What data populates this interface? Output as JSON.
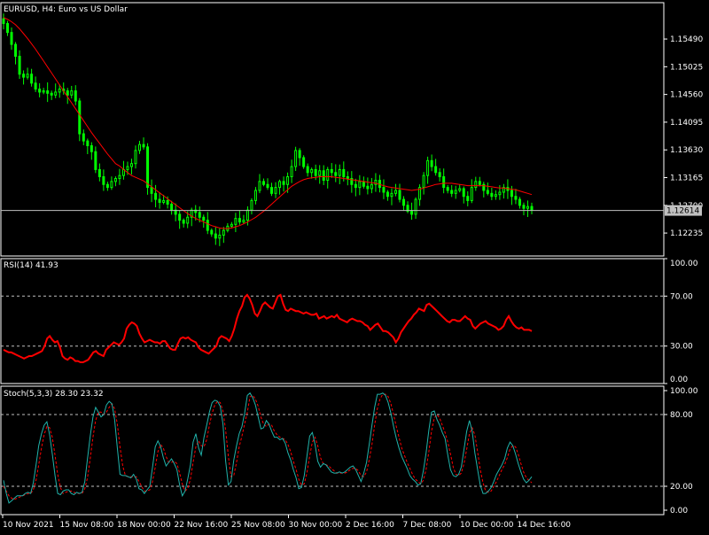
{
  "main": {
    "title": "EURUSD, H4:  Euro vs US Dollar",
    "ylim": [
      1.1185,
      1.161
    ],
    "ticks": [
      {
        "label": "1.15490",
        "value": 1.1549
      },
      {
        "label": "1.15025",
        "value": 1.15025
      },
      {
        "label": "1.14560",
        "value": 1.1456
      },
      {
        "label": "1.14095",
        "value": 1.14095
      },
      {
        "label": "1.13630",
        "value": 1.1363
      },
      {
        "label": "1.13165",
        "value": 1.13165
      },
      {
        "label": "1.12700",
        "value": 1.127
      },
      {
        "label": "1.12235",
        "value": 1.12235
      }
    ],
    "current_price": "1.12614",
    "current_value": 1.12614,
    "colors": {
      "candle": "#00ff00",
      "ma": "#ff0000",
      "price_line": "#c0c0c0",
      "price_box": "#c0c0c0"
    }
  },
  "rsi": {
    "label": "RSI(14) 41.93",
    "ylim": [
      0,
      100
    ],
    "ticks": [
      {
        "label": "100.00",
        "value": 100
      },
      {
        "label": "70.00",
        "value": 70
      },
      {
        "label": "30.00",
        "value": 30
      },
      {
        "label": "0.00",
        "value": 0
      }
    ],
    "levels": [
      70,
      30
    ],
    "color": "#ff0000"
  },
  "stoch": {
    "label": "Stoch(5,3,3) 28.30 23.32",
    "ylim": [
      0,
      100
    ],
    "ticks": [
      {
        "label": "100.00",
        "value": 100
      },
      {
        "label": "80.00",
        "value": 80
      },
      {
        "label": "20.00",
        "value": 20
      },
      {
        "label": "0.00",
        "value": 0
      }
    ],
    "levels": [
      80,
      20
    ],
    "main_color": "#20b2aa",
    "signal_color": "#ff0000"
  },
  "time_axis": [
    "10 Nov 2021",
    "15 Nov 08:00",
    "18 Nov 00:00",
    "22 Nov 16:00",
    "25 Nov 08:00",
    "30 Nov 00:00",
    "2 Dec 16:00",
    "7 Dec 08:00",
    "10 Dec 00:00",
    "14 Dec 16:00"
  ],
  "chart_data": [
    {
      "type": "candlestick",
      "title": "EURUSD, H4:  Euro vs US Dollar",
      "x_labels": [
        "10 Nov 2021",
        "15 Nov 08:00",
        "18 Nov 00:00",
        "22 Nov 16:00",
        "25 Nov 08:00",
        "30 Nov 00:00",
        "2 Dec 16:00",
        "7 Dec 08:00",
        "10 Dec 00:00",
        "14 Dec 16:00"
      ],
      "close": [
        1.1575,
        1.156,
        1.154,
        1.152,
        1.149,
        1.1485,
        1.149,
        1.1475,
        1.1465,
        1.146,
        1.1462,
        1.1458,
        1.1455,
        1.146,
        1.1465,
        1.1462,
        1.1455,
        1.1462,
        1.1445,
        1.139,
        1.1378,
        1.137,
        1.136,
        1.133,
        1.1318,
        1.1305,
        1.13,
        1.131,
        1.1315,
        1.132,
        1.133,
        1.1335,
        1.134,
        1.1362,
        1.1372,
        1.1368,
        1.13,
        1.129,
        1.128,
        1.1275,
        1.1278,
        1.1272,
        1.1262,
        1.1255,
        1.1245,
        1.124,
        1.125,
        1.1262,
        1.1258,
        1.125,
        1.1245,
        1.1228,
        1.1222,
        1.1215,
        1.122,
        1.1228,
        1.1235,
        1.1238,
        1.1248,
        1.1242,
        1.1245,
        1.1262,
        1.1278,
        1.1295,
        1.131,
        1.1305,
        1.13,
        1.129,
        1.13,
        1.131,
        1.1305,
        1.1318,
        1.1335,
        1.1362,
        1.135,
        1.1335,
        1.1325,
        1.133,
        1.132,
        1.1328,
        1.1312,
        1.133,
        1.1325,
        1.132,
        1.133,
        1.1318,
        1.1315,
        1.1305,
        1.13,
        1.131,
        1.1302,
        1.1298,
        1.1305,
        1.1312,
        1.13,
        1.1292,
        1.1285,
        1.129,
        1.1295,
        1.128,
        1.127,
        1.126,
        1.1255,
        1.128,
        1.13,
        1.132,
        1.1345,
        1.1335,
        1.1325,
        1.1318,
        1.13,
        1.1295,
        1.129,
        1.1295,
        1.1298,
        1.1285,
        1.1278,
        1.13,
        1.131,
        1.1305,
        1.1295,
        1.129,
        1.1285,
        1.1288,
        1.1292,
        1.13,
        1.1295,
        1.1285,
        1.128,
        1.127,
        1.1265,
        1.1268,
        1.1262
      ],
      "ma": [
        1.1585,
        1.1582,
        1.1578,
        1.1573,
        1.1566,
        1.1558,
        1.155,
        1.1541,
        1.1532,
        1.1522,
        1.1512,
        1.1502,
        1.1492,
        1.1482,
        1.1472,
        1.1462,
        1.1452,
        1.1442,
        1.1432,
        1.1422,
        1.1412,
        1.1402,
        1.1392,
        1.1383,
        1.1374,
        1.1365,
        1.1356,
        1.1348,
        1.134,
        1.1336,
        1.133,
        1.1325,
        1.132,
        1.1317,
        1.1314,
        1.1311,
        1.1306,
        1.1301,
        1.1296,
        1.1291,
        1.1286,
        1.1281,
        1.1276,
        1.1271,
        1.1266,
        1.1261,
        1.1256,
        1.1252,
        1.1248,
        1.1245,
        1.1242,
        1.1239,
        1.1236,
        1.1234,
        1.1232,
        1.1231,
        1.1231,
        1.1232,
        1.1234,
        1.1236,
        1.1239,
        1.1242,
        1.1246,
        1.125,
        1.1255,
        1.126,
        1.1266,
        1.1272,
        1.1278,
        1.1284,
        1.129,
        1.1296,
        1.1302,
        1.1306,
        1.131,
        1.1313,
        1.1315,
        1.1316,
        1.1317,
        1.1318,
        1.1318,
        1.1318,
        1.1318,
        1.1317,
        1.1316,
        1.1315,
        1.1314,
        1.1313,
        1.1312,
        1.1311,
        1.131,
        1.1309,
        1.1308,
        1.1307,
        1.1305,
        1.1303,
        1.1301,
        1.13,
        1.1299,
        1.1298,
        1.1297,
        1.1296,
        1.1295,
        1.1296,
        1.1297,
        1.1299,
        1.1301,
        1.1303,
        1.1305,
        1.1306,
        1.1307,
        1.1307,
        1.1307,
        1.1306,
        1.1305,
        1.1304,
        1.1303,
        1.1303,
        1.1303,
        1.1303,
        1.1303,
        1.1302,
        1.1301,
        1.13,
        1.1299,
        1.1299,
        1.1298,
        1.1297,
        1.1296,
        1.1294,
        1.1292,
        1.129,
        1.1288
      ]
    },
    {
      "type": "line",
      "title": "RSI(14) 41.93",
      "ylim": [
        0,
        100
      ],
      "values": [
        27,
        26,
        25,
        25,
        24,
        23,
        22,
        21,
        20,
        21,
        22,
        22,
        23,
        24,
        25,
        26,
        30,
        36,
        38,
        35,
        33,
        34,
        29,
        22,
        20,
        19,
        21,
        20,
        18,
        18,
        17,
        17,
        18,
        19,
        22,
        25,
        26,
        24,
        23,
        22,
        27,
        29,
        31,
        33,
        32,
        31,
        33,
        36,
        44,
        47,
        49,
        48,
        46,
        40,
        36,
        33,
        34,
        35,
        34,
        33,
        33,
        32,
        34,
        34,
        31,
        28,
        27,
        27,
        32,
        36,
        37,
        36,
        37,
        35,
        34,
        33,
        29,
        27,
        26,
        25,
        24,
        26,
        28,
        30,
        36,
        38,
        37,
        36,
        34,
        38,
        44,
        52,
        58,
        62,
        69,
        71,
        68,
        63,
        56,
        54,
        58,
        63,
        65,
        63,
        61,
        60,
        65,
        70,
        71,
        64,
        59,
        58,
        60,
        59,
        58,
        58,
        57,
        56,
        57,
        56,
        55,
        55,
        56,
        52,
        53,
        54,
        52,
        53,
        54,
        53,
        55,
        52,
        51,
        50,
        49,
        51,
        52,
        51,
        50,
        50,
        49,
        47,
        46,
        43,
        45,
        47,
        48,
        45,
        42,
        42,
        41,
        39,
        37,
        33,
        36,
        41,
        44,
        47,
        50,
        52,
        55,
        57,
        60,
        59,
        58,
        63,
        64,
        62,
        60,
        58,
        56,
        54,
        52,
        50,
        49,
        51,
        51,
        50,
        50,
        52,
        54,
        52,
        51,
        46,
        44,
        46,
        48,
        49,
        50,
        48,
        47,
        46,
        45,
        43,
        44,
        46,
        51,
        54,
        50,
        47,
        45,
        44,
        45,
        43,
        43,
        43,
        42
      ]
    },
    {
      "type": "line",
      "title": "Stoch(5,3,3) 28.30 23.32",
      "ylim": [
        0,
        100
      ],
      "series": [
        {
          "values": [
            25,
            14,
            6,
            8,
            10,
            12,
            12,
            12,
            14,
            15,
            14,
            23,
            38,
            54,
            64,
            71,
            74,
            63,
            47,
            29,
            14,
            13,
            16,
            17,
            17,
            14,
            13,
            15,
            14,
            15,
            24,
            43,
            62,
            78,
            86,
            82,
            78,
            80,
            88,
            91,
            89,
            76,
            52,
            30,
            29,
            29,
            28,
            27,
            30,
            26,
            18,
            17,
            14,
            17,
            20,
            36,
            53,
            58,
            53,
            44,
            37,
            40,
            43,
            39,
            34,
            21,
            12,
            16,
            26,
            38,
            57,
            64,
            52,
            46,
            61,
            71,
            82,
            90,
            92,
            91,
            87,
            72,
            41,
            21,
            24,
            42,
            54,
            64,
            70,
            81,
            96,
            98,
            94,
            88,
            78,
            68,
            69,
            75,
            72,
            66,
            61,
            61,
            59,
            60,
            56,
            48,
            42,
            34,
            27,
            18,
            19,
            29,
            45,
            62,
            65,
            55,
            41,
            36,
            39,
            38,
            35,
            32,
            31,
            31,
            32,
            31,
            32,
            34,
            36,
            37,
            34,
            29,
            24,
            31,
            40,
            55,
            71,
            86,
            97,
            97,
            98,
            96,
            90,
            81,
            70,
            60,
            52,
            45,
            40,
            35,
            29,
            26,
            24,
            21,
            22,
            33,
            48,
            67,
            82,
            83,
            76,
            71,
            65,
            60,
            46,
            34,
            29,
            28,
            30,
            36,
            51,
            66,
            75,
            66,
            48,
            34,
            21,
            14,
            14,
            16,
            19,
            24,
            30,
            34,
            38,
            43,
            52,
            57,
            54,
            47,
            39,
            32,
            26,
            23,
            25,
            28
          ]
        },
        {
          "values": [
            20,
            16,
            12,
            10,
            9,
            10,
            11,
            12,
            13,
            14,
            14,
            17,
            25,
            38,
            52,
            63,
            70,
            69,
            61,
            46,
            30,
            19,
            14,
            15,
            16,
            16,
            15,
            14,
            14,
            14,
            18,
            27,
            43,
            61,
            75,
            82,
            82,
            80,
            82,
            86,
            89,
            85,
            72,
            53,
            37,
            29,
            28,
            28,
            28,
            28,
            24,
            20,
            16,
            16,
            17,
            24,
            36,
            49,
            55,
            52,
            45,
            40,
            40,
            41,
            39,
            31,
            22,
            16,
            18,
            26,
            40,
            53,
            58,
            54,
            53,
            59,
            71,
            81,
            88,
            91,
            90,
            83,
            67,
            45,
            28,
            29,
            40,
            53,
            62,
            72,
            82,
            95,
            96,
            93,
            87,
            78,
            72,
            70,
            72,
            71,
            66,
            63,
            61,
            60,
            59,
            55,
            49,
            41,
            34,
            26,
            21,
            22,
            31,
            45,
            57,
            61,
            54,
            44,
            39,
            38,
            37,
            35,
            33,
            31,
            31,
            31,
            31,
            32,
            34,
            35,
            35,
            33,
            29,
            28,
            32,
            42,
            55,
            71,
            85,
            93,
            97,
            97,
            95,
            89,
            80,
            70,
            61,
            52,
            46,
            40,
            35,
            30,
            26,
            24,
            22,
            25,
            34,
            49,
            66,
            77,
            80,
            77,
            71,
            65,
            57,
            47,
            36,
            30,
            29,
            31,
            39,
            51,
            64,
            69,
            63,
            49,
            34,
            23,
            16,
            15,
            16,
            20,
            24,
            29,
            34,
            38,
            44,
            51,
            54,
            53,
            47,
            39,
            32,
            27,
            25,
            23
          ]
        }
      ]
    }
  ]
}
